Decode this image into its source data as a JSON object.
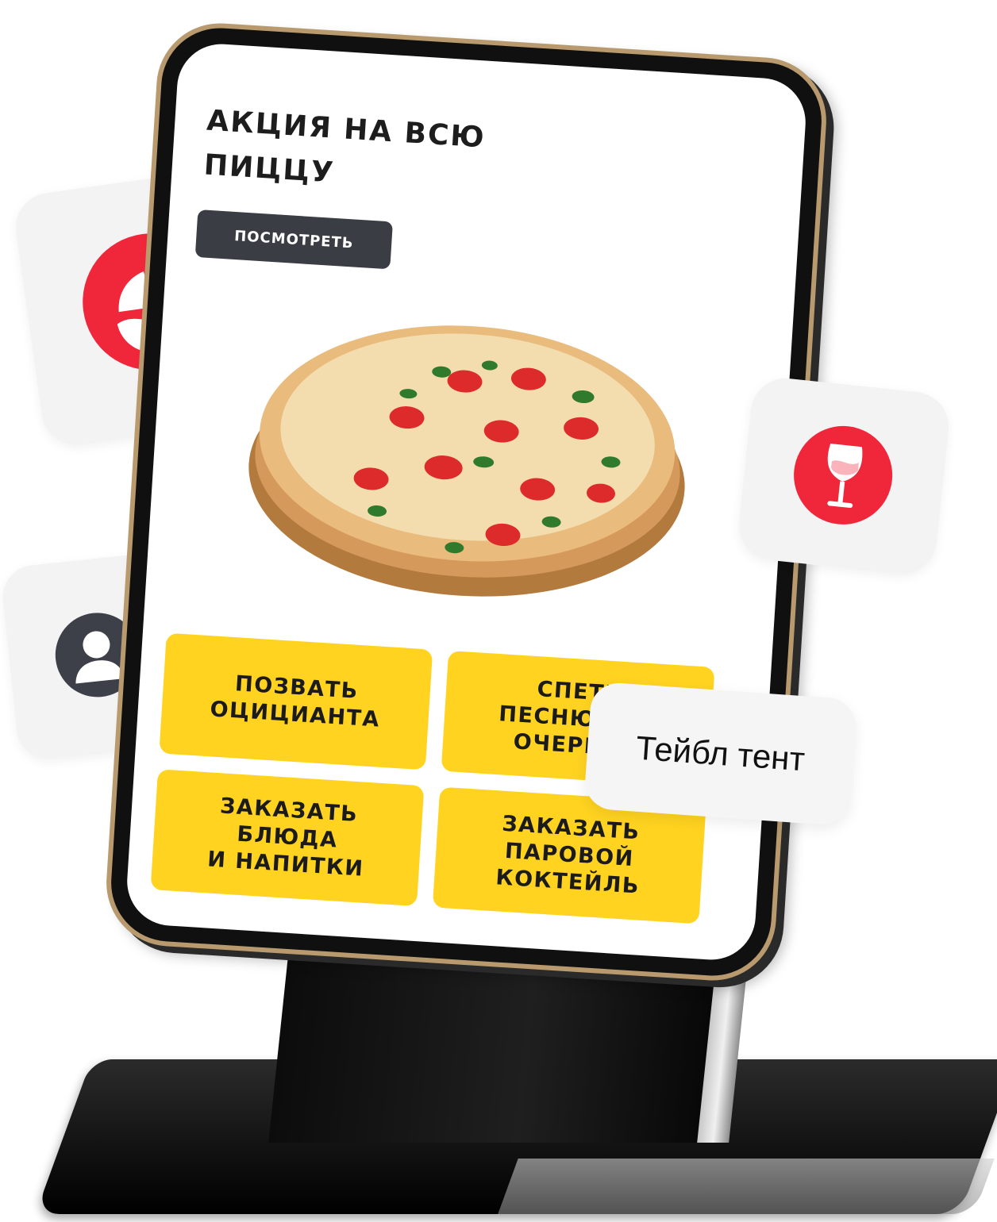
{
  "promo": {
    "title": "АКЦИЯ НА ВСЮ ПИЦЦУ",
    "button_label": "ПОСМОТРЕТЬ"
  },
  "actions": [
    {
      "label": "ПОЗВАТЬ\nОЦИЦИАНТА"
    },
    {
      "label": "СПЕТЬ\nПЕСНЮ ВНЕ\nОЧЕРЕДИ"
    },
    {
      "label": "ЗАКАЗАТЬ\nБЛЮДА\nИ НАПИТКИ"
    },
    {
      "label": "ЗАКАЗАТЬ\nПАРОВОЙ\nКОКТЕЙЛЬ"
    }
  ],
  "badge": {
    "label": "Тейбл тент"
  },
  "icons": {
    "brand": "restaurant-logo-icon",
    "user": "person-icon",
    "drink": "wine-glass-icon"
  },
  "colors": {
    "accent_yellow": "#ffd320",
    "accent_red": "#f0263a",
    "dark_button": "#3a3d44",
    "card_bg": "#f3f3f4"
  }
}
